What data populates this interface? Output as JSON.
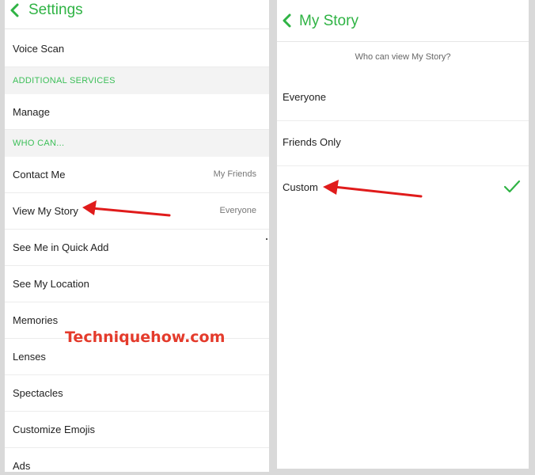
{
  "colors": {
    "accent": "#2fb344",
    "section_text": "#3cbf58",
    "arrow": "#e01b1b",
    "watermark": "#e43b2c"
  },
  "left": {
    "header": {
      "back_icon": "chevron-left-icon",
      "title": "Settings"
    },
    "rows": [
      {
        "label": "Voice Scan",
        "value": ""
      }
    ],
    "section_additional": "ADDITIONAL SERVICES",
    "manage": "Manage",
    "section_who": "WHO CAN...",
    "who_rows": [
      {
        "label": "Contact Me",
        "value": "My Friends"
      },
      {
        "label": "View My Story",
        "value": "Everyone"
      },
      {
        "label": "See Me in Quick Add",
        "value": ""
      },
      {
        "label": "See My Location",
        "value": ""
      },
      {
        "label": "Memories",
        "value": ""
      },
      {
        "label": "Lenses",
        "value": ""
      },
      {
        "label": "Spectacles",
        "value": ""
      },
      {
        "label": "Customize Emojis",
        "value": ""
      },
      {
        "label": "Ads",
        "value": ""
      }
    ],
    "watermark": "Techniquehow.com"
  },
  "right": {
    "header": {
      "back_icon": "chevron-left-icon",
      "title": "My Story"
    },
    "question": "Who can view My Story?",
    "options": [
      {
        "label": "Everyone",
        "selected": false
      },
      {
        "label": "Friends Only",
        "selected": false
      },
      {
        "label": "Custom",
        "selected": true
      }
    ],
    "check_icon": "checkmark-icon"
  }
}
